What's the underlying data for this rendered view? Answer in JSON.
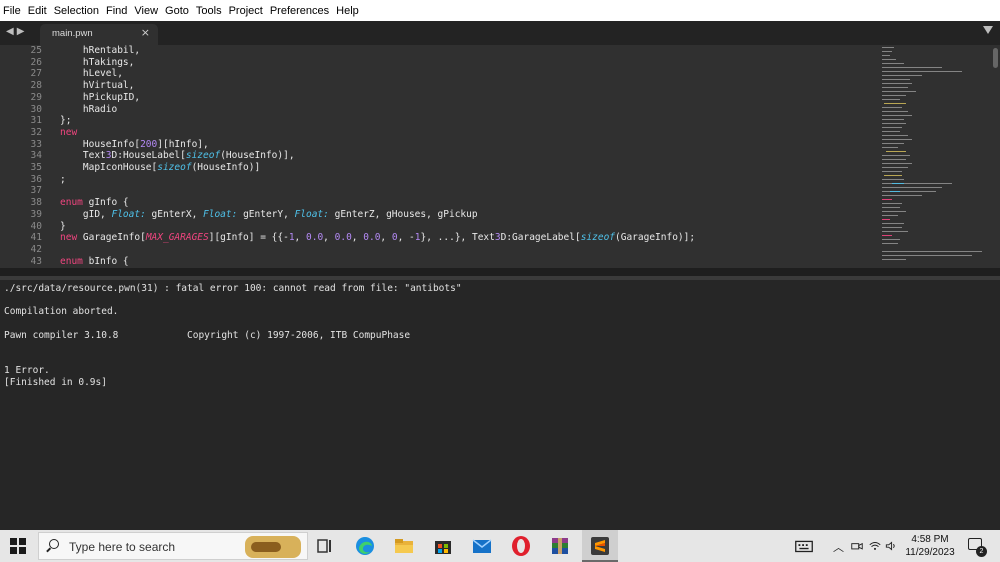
{
  "menu": [
    "File",
    "Edit",
    "Selection",
    "Find",
    "View",
    "Goto",
    "Tools",
    "Project",
    "Preferences",
    "Help"
  ],
  "tab": {
    "label": "main.pwn",
    "close_glyph": "×"
  },
  "line_numbers": [
    "25",
    "26",
    "27",
    "28",
    "29",
    "30",
    "31",
    "32",
    "33",
    "34",
    "35",
    "36",
    "37",
    "38",
    "39",
    "40",
    "41",
    "42",
    "43"
  ],
  "code": {
    "l25": "    hRentabil,",
    "l26": "    hTakings,",
    "l27": "    hLevel,",
    "l28": "    hVirtual,",
    "l29": "    hPickupID,",
    "l30": "    hRadio",
    "l31": "};",
    "l32": "new",
    "l33a": "    HouseInfo[",
    "l33b": "200",
    "l33c": "][hInfo],",
    "l34a": "    Text",
    "l34b": "3",
    "l34c": "D:HouseLabel[",
    "l34d": "sizeof",
    "l34e": "(HouseInfo)],",
    "l35a": "    MapIconHouse[",
    "l35b": "sizeof",
    "l35c": "(HouseInfo)]",
    "l36": ";",
    "l38a": "enum",
    "l38b": " gInfo {",
    "l39a": "    gID, ",
    "l39b": "Float:",
    "l39c": " gEnterX, ",
    "l39d": "Float:",
    "l39e": " gEnterY, ",
    "l39f": "Float:",
    "l39g": " gEnterZ, gHouses, gPickup",
    "l40": "}",
    "l41a": "new",
    "l41b": " GarageInfo[",
    "l41c": "MAX_GARAGES",
    "l41d": "][gInfo] = {{-",
    "l41e": "1",
    "l41f": ", ",
    "l41g": "0.0",
    "l41h": ", ",
    "l41i": "0.0",
    "l41j": ", ",
    "l41k": "0.0",
    "l41l": ", ",
    "l41m": "0",
    "l41n": ", -",
    "l41o": "1",
    "l41p": "}, ...}, Text",
    "l41q": "3",
    "l41r": "D:GarageLabel[",
    "l41s": "sizeof",
    "l41t": "(GarageInfo)];",
    "l43a": "enum",
    "l43b": " bInfo {"
  },
  "output": {
    "line1": "./src/data/resource.pwn(31) : fatal error 100: cannot read from file: \"antibots\"",
    "line2": "Compilation aborted.",
    "line3": "Pawn compiler 3.10.8            Copyright (c) 1997-2006, ITB CompuPhase",
    "line4": "1 Error.",
    "line5": "[Finished in 0.9s]"
  },
  "taskbar": {
    "search_placeholder": "Type here to search",
    "apps": [
      "task-view-icon",
      "edge-icon",
      "file-explorer-icon",
      "store-icon",
      "mail-icon",
      "opera-icon",
      "winrar-icon",
      "sublime-text-icon"
    ],
    "time": "4:58 PM",
    "date": "11/29/2023",
    "notification_count": "2"
  },
  "colors": {
    "keyword": "#f0457f",
    "type": "#4fc1e9",
    "number": "#b48af5",
    "editor_bg": "#303030",
    "output_bg": "#262626"
  }
}
